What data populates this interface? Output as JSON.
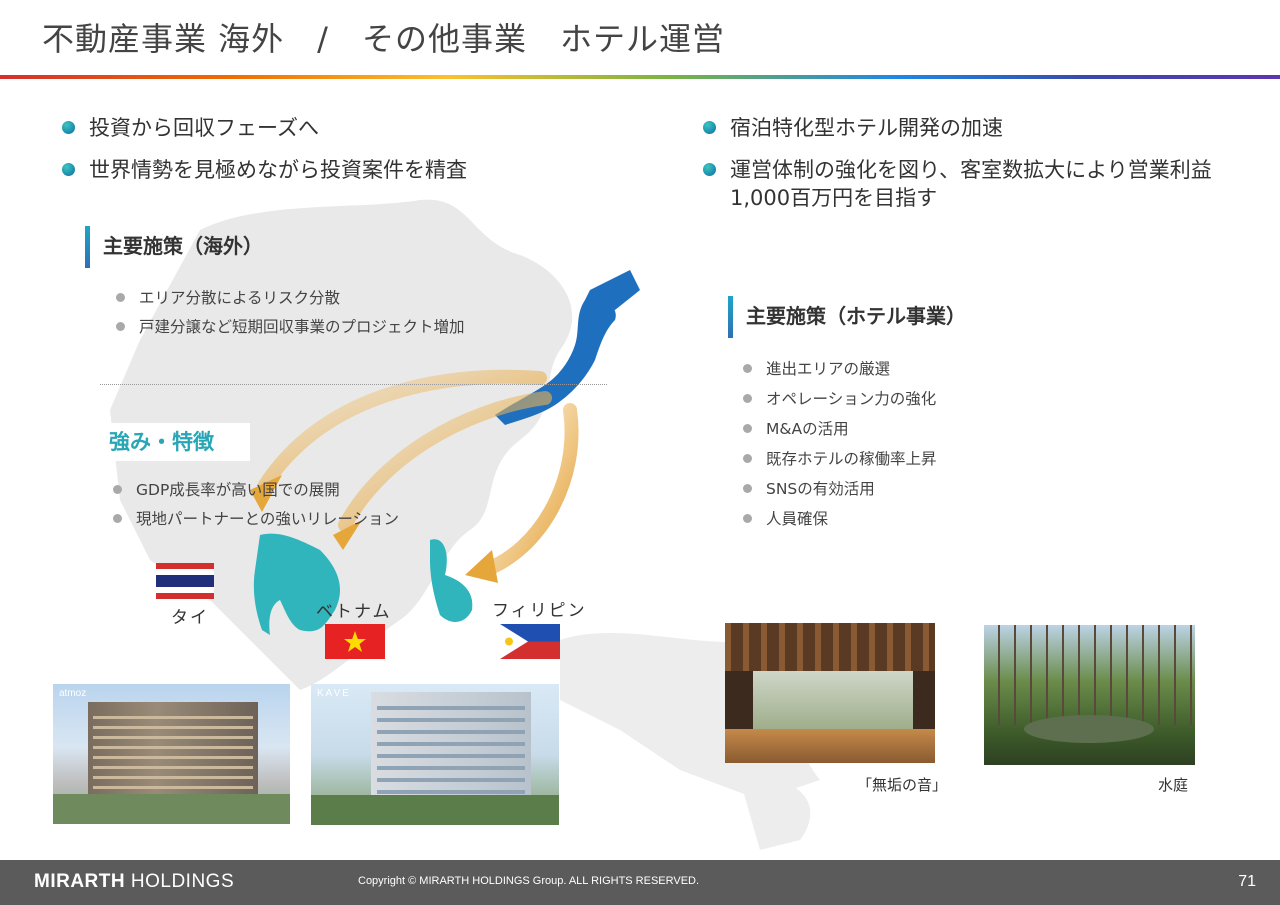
{
  "header": {
    "title": "不動産事業 海外　/　その他事業　ホテル運営"
  },
  "left": {
    "bullets": [
      "投資から回収フェーズへ",
      "世界情勢を見極めながら投資案件を精査"
    ],
    "measures_heading": "主要施策（海外）",
    "measures": [
      "エリア分散によるリスク分散",
      "戸建分譲など短期回収事業のプロジェクト増加"
    ],
    "strength_heading": "強み・特徴",
    "strengths": [
      "GDP成長率が高い国での展開",
      "現地パートナーとの強いリレーション"
    ],
    "countries": [
      "タイ",
      "ベトナム",
      "フィリピン"
    ],
    "photo_logos": [
      "atmoz",
      "KAVE"
    ]
  },
  "right": {
    "bullets": [
      "宿泊特化型ホテル開発の加速",
      "運営体制の強化を図り、客室数拡大により営業利益",
      "1,000百万円を目指す"
    ],
    "measures_heading": "主要施策（ホテル事業）",
    "measures": [
      "進出エリアの厳選",
      "オペレーション力の強化",
      "M&Aの活用",
      "既存ホテルの稼働率上昇",
      "SNSの有効活用",
      "人員確保"
    ],
    "captions": [
      "「無垢の音」",
      "水庭"
    ]
  },
  "footer": {
    "brand_bold": "MIRARTH",
    "brand_rest": "HOLDINGS",
    "copyright": "Copyright © MIRARTH HOLDINGS Group. ALL RIGHTS RESERVED.",
    "page": "71"
  },
  "colors": {
    "teal": "#28a6b6",
    "japan_blue": "#1565c0",
    "map_teal": "#2db5bb",
    "arrow_gold": "#e5a63a",
    "footer_bg": "#5b5b5b"
  }
}
